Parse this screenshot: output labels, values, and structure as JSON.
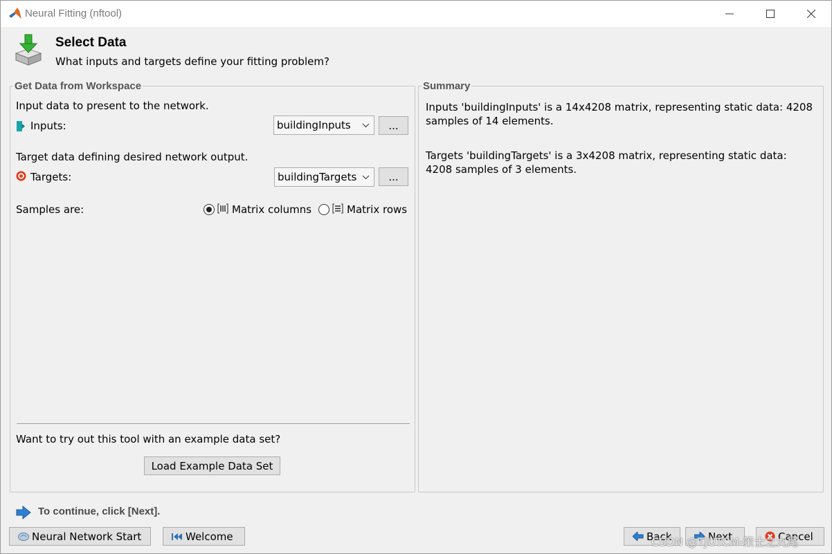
{
  "window": {
    "title": "Neural Fitting (nftool)"
  },
  "header": {
    "title": "Select Data",
    "subtitle": "What inputs and targets define your fitting problem?"
  },
  "get_data": {
    "legend": "Get Data from Workspace",
    "inputs_desc": "Input data to present to the network.",
    "inputs_label": "Inputs:",
    "inputs_value": "buildingInputs",
    "targets_desc": "Target data defining desired network output.",
    "targets_label": "Targets:",
    "targets_value": "buildingTargets",
    "browse_label": "...",
    "samples_label": "Samples are:",
    "option_columns": "Matrix columns",
    "option_rows": "Matrix rows",
    "selected_option": "Matrix columns",
    "example_prompt": "Want to try out this tool with an example data set?",
    "load_example_label": "Load Example Data Set"
  },
  "summary": {
    "legend": "Summary",
    "inputs_text": "Inputs 'buildingInputs' is a 14x4208 matrix, representing static data: 4208 samples of 14 elements.",
    "targets_text": "Targets 'buildingTargets' is a 3x4208 matrix, representing static data: 4208 samples of 3 elements."
  },
  "footer": {
    "hint": "To continue, click [Next].",
    "nn_start_label": "Neural Network Start",
    "welcome_label": "Welcome",
    "back_label": "Back",
    "next_label": "Next",
    "cancel_label": "Cancel"
  },
  "watermark": "CSDN @TJUTCM-策士之九尾",
  "colors": {
    "hint_arrow": "#2f7fd0",
    "inputs_icon": "#1aa3a8",
    "targets_icon": "#e23b1c"
  }
}
